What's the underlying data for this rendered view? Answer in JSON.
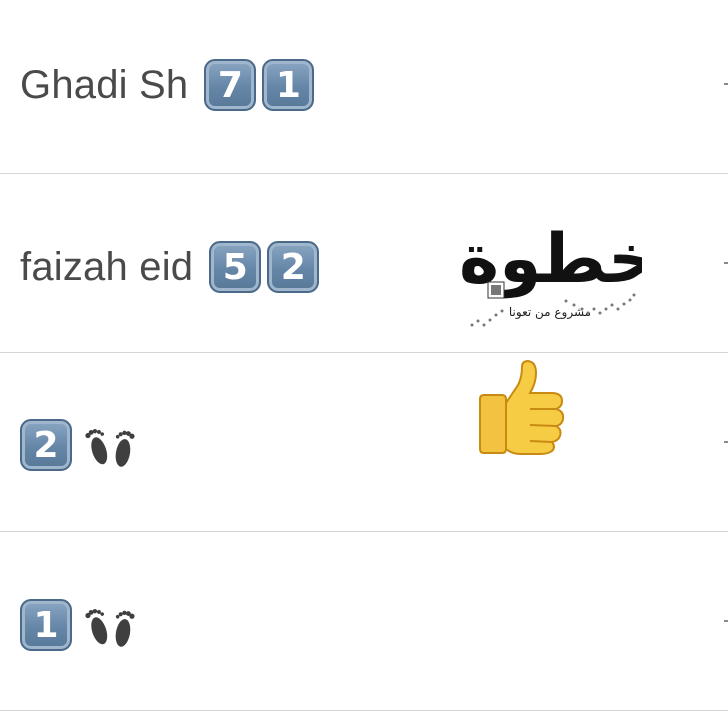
{
  "rows": [
    {
      "name": "Ghadi Sh",
      "digits": [
        "7",
        "1"
      ]
    },
    {
      "name": "faizah eid",
      "digits": [
        "5",
        "2"
      ]
    },
    {
      "name": "",
      "digits": [
        "2"
      ],
      "icon": "footprints-icon"
    },
    {
      "name": "",
      "digits": [
        "1"
      ],
      "icon": "footprints-icon"
    }
  ],
  "logo": {
    "title": "خطوة",
    "subtitle": "مشروع من تعونا"
  },
  "reaction": {
    "icon": "thumbs-up-icon",
    "color": "#f2c23a"
  }
}
